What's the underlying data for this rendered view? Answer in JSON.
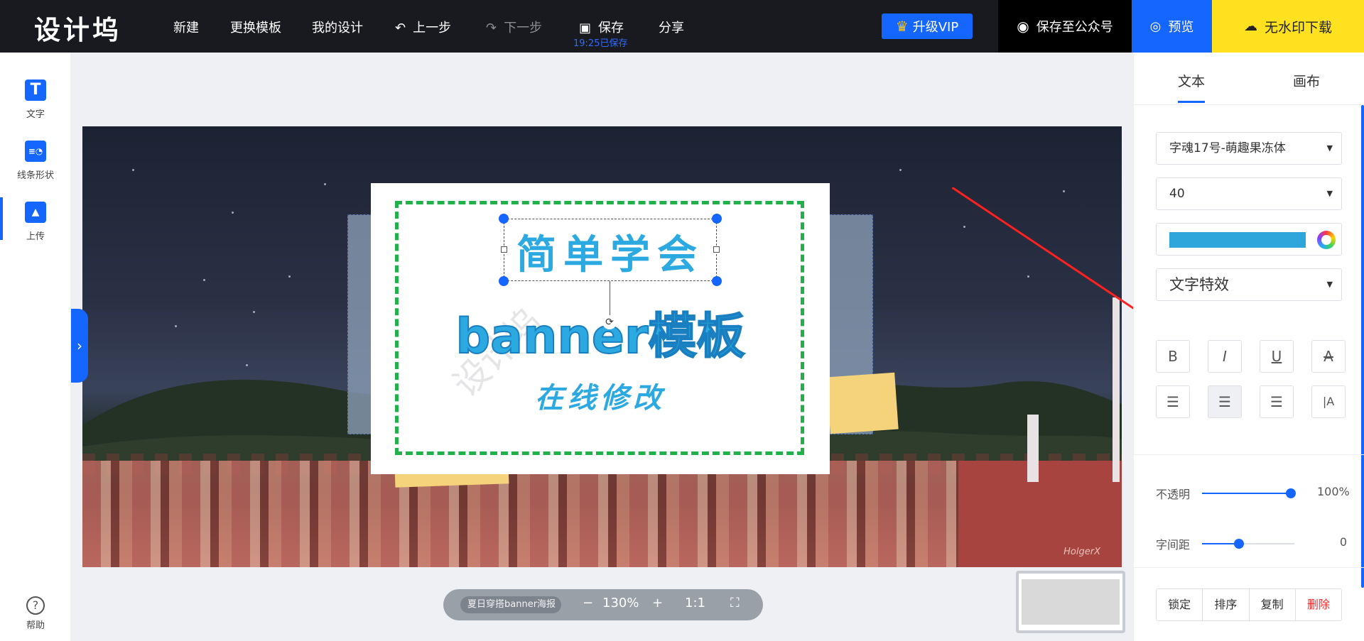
{
  "app": {
    "logo": "设计坞"
  },
  "topnav": {
    "new": "新建",
    "change_template": "更换模板",
    "my_designs": "我的设计",
    "undo": "上一步",
    "redo": "下一步",
    "save": "保存",
    "saved_time": "19:25已保存",
    "share": "分享",
    "vip": "升级VIP",
    "save_wechat": "保存至公众号",
    "preview": "预览",
    "download": "无水印下载"
  },
  "sidebar": {
    "items": [
      {
        "label": "文字",
        "icon": "text-icon"
      },
      {
        "label": "线条形状",
        "icon": "shapes-icon"
      },
      {
        "label": "上传",
        "icon": "upload-icon"
      }
    ],
    "help": "帮助"
  },
  "canvas": {
    "title1": "简单学会",
    "title2": "banner模板",
    "title3": "在线修改",
    "watermark": "设计坞",
    "signature": "HolgerX"
  },
  "zoombar": {
    "doc_name": "夏日穿搭banner海报",
    "minus": "−",
    "zoom": "130%",
    "plus": "+",
    "ratio": "1:1"
  },
  "panel": {
    "tabs": [
      "文本",
      "画布"
    ],
    "font": "字魂17号-萌趣果冻体",
    "size": "40",
    "color": "#2ea6dc",
    "effect": "文字特效",
    "format_buttons": [
      "B",
      "I",
      "U",
      "A"
    ],
    "align_buttons": [
      "left",
      "center",
      "right",
      "vertical"
    ],
    "opacity_label": "不透明",
    "opacity_value": "100%",
    "opacity_level": 1.0,
    "spacing_label": "字间距",
    "spacing_value": "0",
    "spacing_level": 0.4,
    "actions": [
      "锁定",
      "排序",
      "复制",
      "删除"
    ]
  }
}
